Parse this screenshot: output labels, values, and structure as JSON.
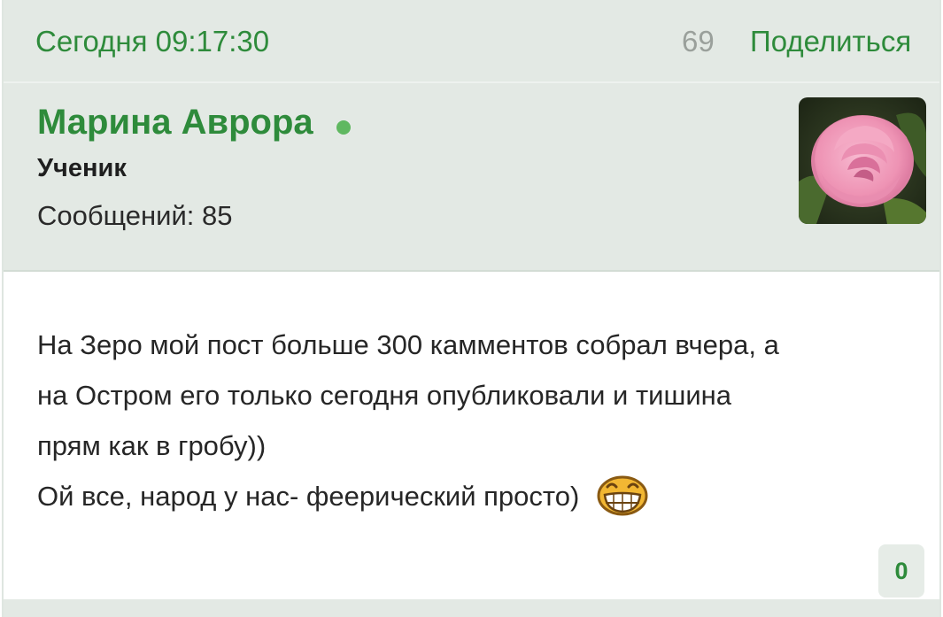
{
  "post": {
    "date": "Сегодня 09:17:30",
    "views": "69",
    "share_label": "Поделиться",
    "author": {
      "name": "Марина Аврора",
      "rank": "Ученик",
      "posts_label": "Сообщений: 85",
      "online": true
    },
    "message_lines": [
      "На Зеро мой пост больше 300 камментов собрал вчера, а",
      "на Остром его только сегодня опубликовали и тишина",
      "прям как в гробу))",
      "Ой все, народ у нас- феерический просто)"
    ],
    "likes": "0"
  },
  "colors": {
    "accent_green": "#2e8b3b",
    "header_bg": "#e3e9e4",
    "online_dot": "#5fb860"
  },
  "icons": {
    "avatar": "pink-rose-avatar",
    "smiley": "laughing-smiley-icon"
  }
}
